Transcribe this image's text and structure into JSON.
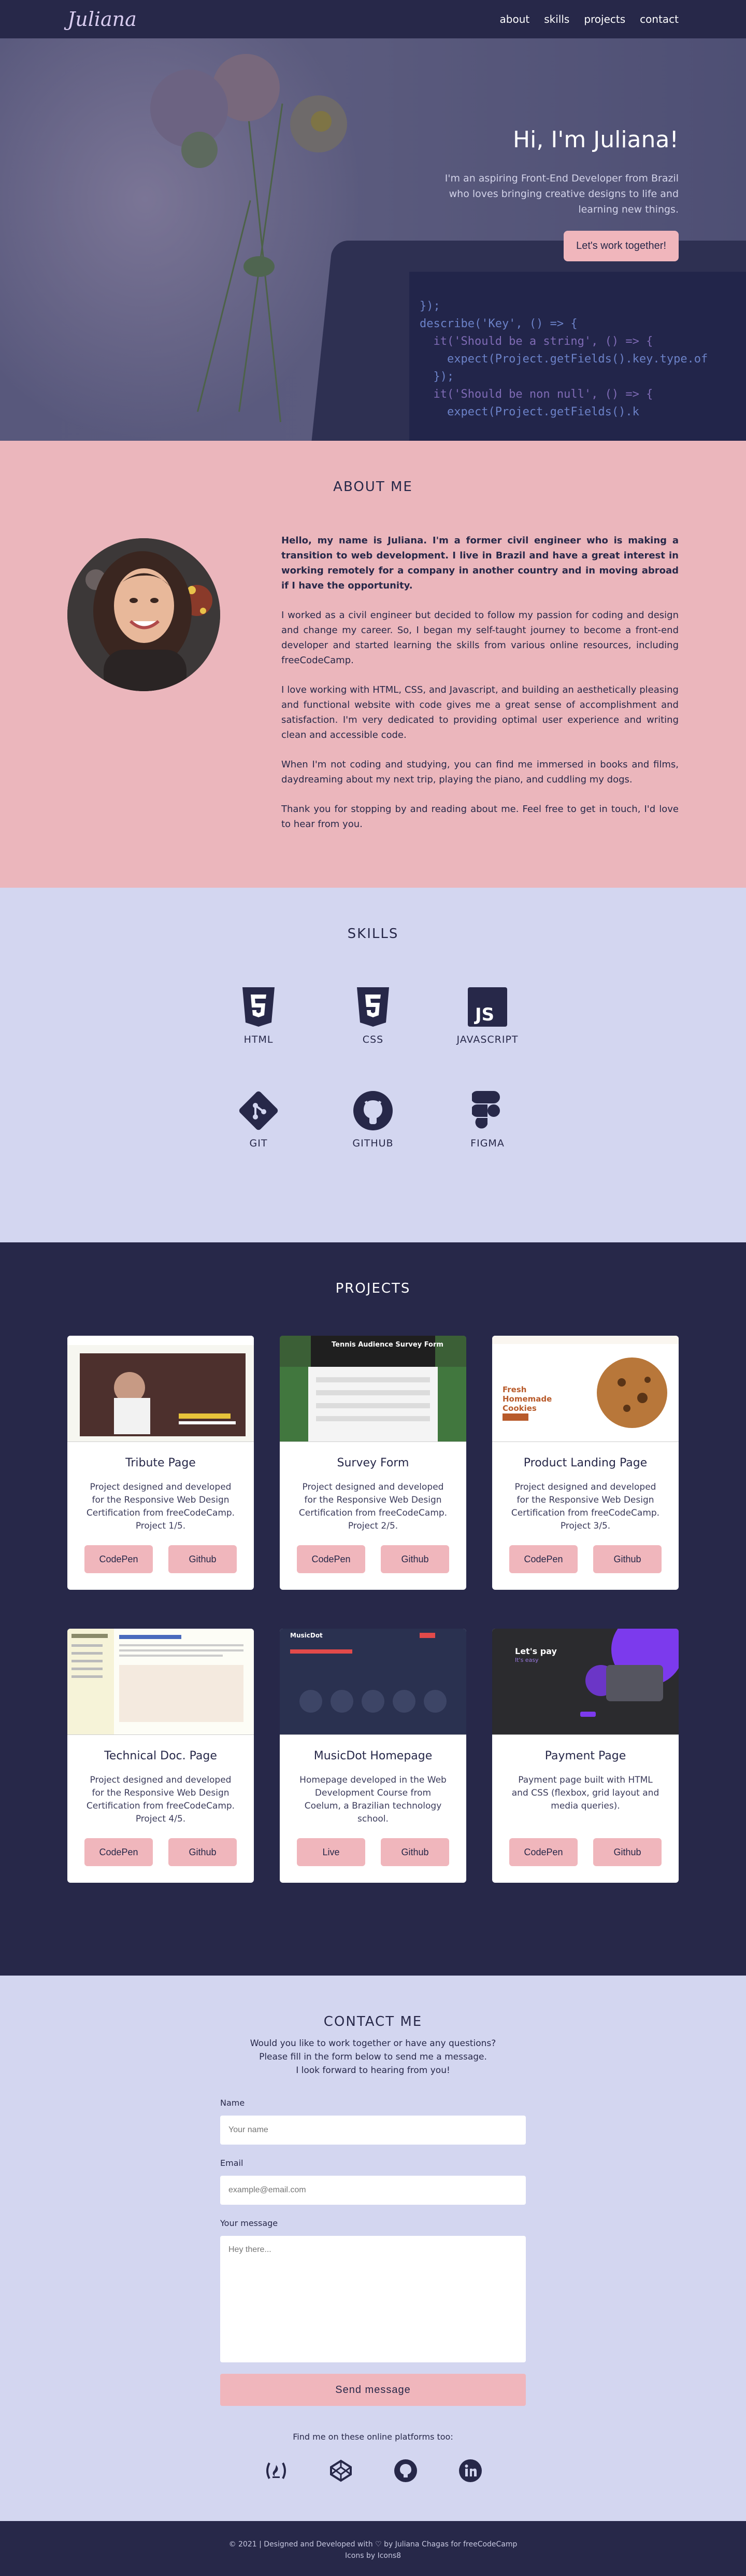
{
  "nav": {
    "logo": "Juliana",
    "links": [
      "about",
      "skills",
      "projects",
      "contact"
    ]
  },
  "hero": {
    "title": "Hi, I'm Juliana!",
    "subtitle_lines": [
      "I'm an aspiring Front-End Developer from Brazil",
      "who loves bringing creative designs to life and",
      "learning new things."
    ],
    "cta": "Let's work together!",
    "code_lines": [
      "});",
      "describe('Key', () => {",
      "  it('Should be a string', () => {",
      "    expect(Project.getFields().key.type.of",
      "  });",
      "  it('Should be non null', () => {",
      "    expect(Project.getFields().k"
    ]
  },
  "about": {
    "title": "ABOUT ME",
    "paragraphs": [
      "Hello, my name is Juliana. I'm a former civil engineer who is making a transition to web development. I live in Brazil and have a great interest in working remotely for a company in another country and in moving abroad if I have the opportunity.",
      "I worked as a civil engineer but decided to follow my passion for coding and design and change my career. So, I began my self-taught journey to become a front-end developer and started learning the skills from various online resources, including freeCodeCamp.",
      "I love working with HTML, CSS, and Javascript, and building an aesthetically pleasing and functional website with code gives me a great sense of accomplishment and satisfaction. I'm very dedicated to providing optimal user experience and writing clean and accessible code.",
      "When I'm not coding and studying, you can find me immersed in books and films, daydreaming about my next trip, playing the piano, and cuddling my dogs.",
      "Thank you for stopping by and reading about me. Feel free to get in touch, I'd love to hear from you."
    ]
  },
  "skills": {
    "title": "SKILLS",
    "items": [
      "HTML",
      "CSS",
      "JAVASCRIPT",
      "GIT",
      "GITHUB",
      "FIGMA"
    ]
  },
  "projects": {
    "title": "PROJECTS",
    "cards": [
      {
        "title": "Tribute Page",
        "desc": "Project designed and developed for the Responsive Web Design Certification from freeCodeCamp. Project 1/5.",
        "btn1": "CodePen",
        "btn2": "Github"
      },
      {
        "title": "Survey Form",
        "desc": "Project designed and developed for the Responsive Web Design Certification from freeCodeCamp. Project 2/5.",
        "btn1": "CodePen",
        "btn2": "Github"
      },
      {
        "title": "Product Landing Page",
        "desc": "Project designed and developed for the Responsive Web Design Certification from freeCodeCamp. Project 3/5.",
        "btn1": "CodePen",
        "btn2": "Github"
      },
      {
        "title": "Technical Doc. Page",
        "desc": "Project designed and developed for the Responsive Web Design Certification from freeCodeCamp. Project 4/5.",
        "btn1": "CodePen",
        "btn2": "Github"
      },
      {
        "title": "MusicDot Homepage",
        "desc": "Homepage developed in the Web Development Course from Coelum, a Brazilian technology school.",
        "btn1": "Live",
        "btn2": "Github"
      },
      {
        "title": "Payment Page",
        "desc": "Payment page built with HTML and CSS (flexbox, grid layout and media queries).",
        "btn1": "CodePen",
        "btn2": "Github"
      }
    ],
    "thumbs": {
      "survey_title": "Tennis Audience Survey Form",
      "landing_title": "Fresh Homemade Cookies",
      "musicdot_logo": "MusicDot",
      "payment_title": "Let's pay",
      "payment_sub": "It's easy"
    }
  },
  "contact": {
    "title": "CONTACT ME",
    "intro_lines": [
      "Would you like to work together or have any questions?",
      "Please fill in the form below to send me a message.",
      "I look forward to hearing from you!"
    ],
    "name_label": "Name",
    "name_placeholder": "Your name",
    "email_label": "Email",
    "email_placeholder": "example@email.com",
    "message_label": "Your message",
    "message_placeholder": "Hey there...",
    "send": "Send message",
    "find_me": "Find me on these online platforms too:",
    "socials": [
      "freecodecamp-icon",
      "codepen-icon",
      "github-icon",
      "linkedin-icon"
    ]
  },
  "footer": {
    "line1": "© 2021 | Designed and Developed with ♡ by Juliana Chagas for freeCodeCamp",
    "line2": "Icons by Icons8"
  },
  "colors": {
    "navy": "#272849",
    "pink": "#ebb6bc",
    "lavender": "#d3d6f0",
    "button_pink": "#f0b6bc"
  }
}
